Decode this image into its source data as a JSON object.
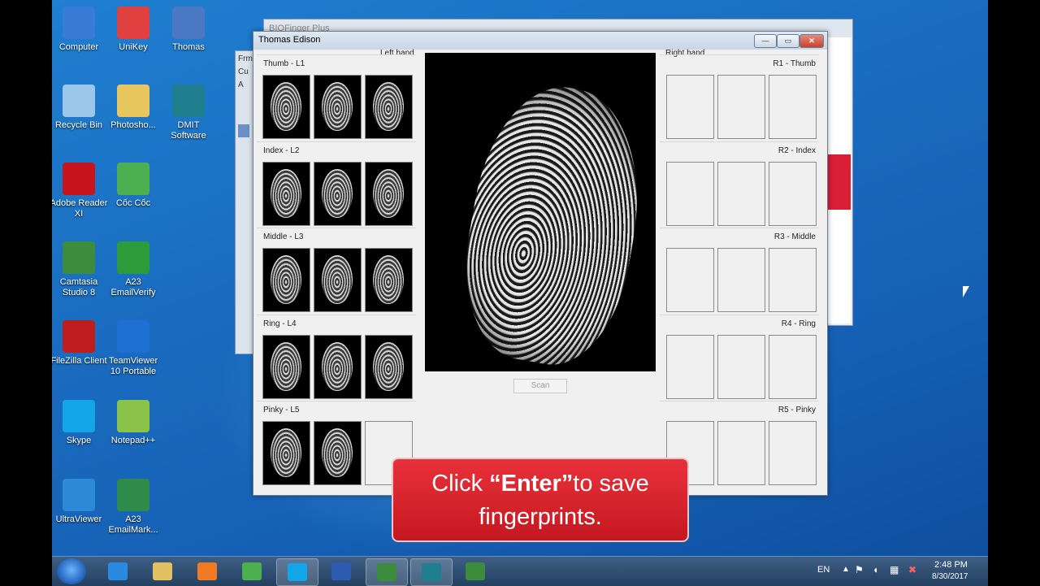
{
  "desktop": {
    "icons": [
      {
        "label": "Computer",
        "icon": "computer-icon",
        "color": "#3a7bd5"
      },
      {
        "label": "UniKey",
        "icon": "unikey-icon",
        "color": "#e04040"
      },
      {
        "label": "Thomas",
        "icon": "word-document-icon",
        "color": "#4a78c2"
      },
      {
        "label": "Recycle Bin",
        "icon": "recycle-bin-icon",
        "color": "#9cc6ea"
      },
      {
        "label": "Photosho...",
        "icon": "folder-icon",
        "color": "#e8c660"
      },
      {
        "label": "DMIT Software",
        "icon": "dmit-app-icon",
        "color": "#1f7f8f"
      },
      {
        "label": "Adobe Reader XI",
        "icon": "adobe-reader-icon",
        "color": "#c8141c"
      },
      {
        "label": "Cốc Cốc",
        "icon": "coccoc-browser-icon",
        "color": "#4caf50"
      },
      {
        "label": "Camtasia Studio 8",
        "icon": "camtasia-icon",
        "color": "#3d8c3d"
      },
      {
        "label": "A23 EmailVerify",
        "icon": "a23-emailverify-icon",
        "color": "#2e9b3a"
      },
      {
        "label": "FileZilla Client",
        "icon": "filezilla-icon",
        "color": "#bf1e1e"
      },
      {
        "label": "TeamViewer 10 Portable",
        "icon": "teamviewer-icon",
        "color": "#1d6fd1"
      },
      {
        "label": "Skype",
        "icon": "skype-icon",
        "color": "#12a5e8"
      },
      {
        "label": "Notepad++",
        "icon": "notepadpp-icon",
        "color": "#8bc34a"
      },
      {
        "label": "UltraViewer",
        "icon": "ultraviewer-icon",
        "color": "#2d8ad8"
      },
      {
        "label": "A23 EmailMark...",
        "icon": "a23-emailmarketing-icon",
        "color": "#2e8b4a"
      }
    ]
  },
  "back_window": {
    "title": "BIOFinger Plus",
    "frm_label": "Frm",
    "cu_label": "Cu",
    "a_label": "A"
  },
  "main_window": {
    "title": "Thomas Edison",
    "left_hand_label": "Left hand",
    "right_hand_label": "Right hand",
    "left_groups": [
      {
        "label": "Thumb - L1",
        "scans": [
          true,
          true,
          true
        ]
      },
      {
        "label": "Index - L2",
        "scans": [
          true,
          true,
          true
        ]
      },
      {
        "label": "Middle - L3",
        "scans": [
          true,
          true,
          true
        ]
      },
      {
        "label": "Ring - L4",
        "scans": [
          true,
          true,
          true
        ]
      },
      {
        "label": "Pinky - L5",
        "scans": [
          true,
          true,
          false
        ]
      }
    ],
    "right_groups": [
      {
        "label": "R1 - Thumb",
        "scans": [
          false,
          false,
          false
        ]
      },
      {
        "label": "R2 - Index",
        "scans": [
          false,
          false,
          false
        ]
      },
      {
        "label": "R3 - Middle",
        "scans": [
          false,
          false,
          false
        ]
      },
      {
        "label": "R4 - Ring",
        "scans": [
          false,
          false,
          false
        ]
      },
      {
        "label": "R5 - Pinky",
        "scans": [
          false,
          false,
          false
        ]
      }
    ],
    "scan_button": "Scan"
  },
  "caption": {
    "prefix": "Click ",
    "bold": "“Enter”",
    "suffix": "to save fingerprints."
  },
  "taskbar": {
    "items": [
      {
        "icon": "internet-explorer-icon",
        "color": "#2a8ae0",
        "active": false
      },
      {
        "icon": "file-explorer-icon",
        "color": "#e0c060",
        "active": false
      },
      {
        "icon": "media-player-icon",
        "color": "#f07a22",
        "active": false
      },
      {
        "icon": "coccoc-browser-icon",
        "color": "#4caf50",
        "active": false
      },
      {
        "icon": "skype-icon",
        "color": "#12a5e8",
        "active": true
      },
      {
        "icon": "word-icon",
        "color": "#2b5cb0",
        "active": false
      },
      {
        "icon": "camtasia-icon",
        "color": "#3d8c3d",
        "active": true
      },
      {
        "icon": "dmit-app-icon",
        "color": "#1f7f8f",
        "active": true
      },
      {
        "icon": "camtasia-recorder-icon",
        "color": "#3d8c3d",
        "active": false
      }
    ],
    "language": "EN",
    "time": "2:48 PM",
    "date": "8/30/2017"
  }
}
